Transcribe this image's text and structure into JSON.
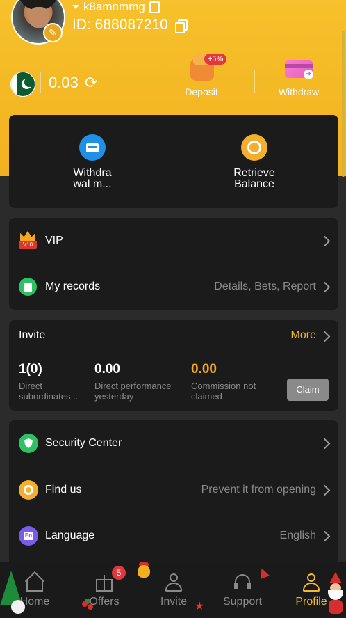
{
  "header": {
    "username": "k8amnmmg",
    "user_id": "ID: 688087210",
    "balance": "0.03",
    "deposit": {
      "label": "Deposit",
      "badge": "+5%"
    },
    "withdraw": {
      "label": "Withdraw"
    }
  },
  "wallet_card": {
    "withdrawal_method_label": "Withdra\nwal m...",
    "retrieve_balance_label": "Retrieve\nBalance"
  },
  "menu1": {
    "vip": {
      "label": "VIP",
      "tag": "V10"
    },
    "records": {
      "label": "My records",
      "value": "Details, Bets, Report"
    }
  },
  "invite": {
    "title": "Invite",
    "more": "More",
    "stats": [
      {
        "value": "1(0)",
        "desc": "Direct\nsubordinates..."
      },
      {
        "value": "0.00",
        "desc": "Direct performance\nyesterday"
      },
      {
        "value": "0.00",
        "desc": "Commission not\nclaimed"
      }
    ],
    "claim_label": "Claim"
  },
  "menu2": {
    "security": {
      "label": "Security Center"
    },
    "find_us": {
      "label": "Find us",
      "value": "Prevent it from opening"
    },
    "language": {
      "label": "Language",
      "value": "English",
      "icon_text": "En"
    }
  },
  "bottom_nav": {
    "items": [
      {
        "label": "Home",
        "icon": "home-icon"
      },
      {
        "label": "Offers",
        "icon": "gift-icon",
        "badge": "5"
      },
      {
        "label": "Invite",
        "icon": "people-icon"
      },
      {
        "label": "Support",
        "icon": "headset-icon"
      },
      {
        "label": "Profile",
        "icon": "profile-icon",
        "active": true
      }
    ]
  },
  "colors": {
    "header_gold": "#f6c12c",
    "accent": "#f5b731",
    "card_bg": "#1b1b1b",
    "page_bg": "#2b2b2b"
  }
}
